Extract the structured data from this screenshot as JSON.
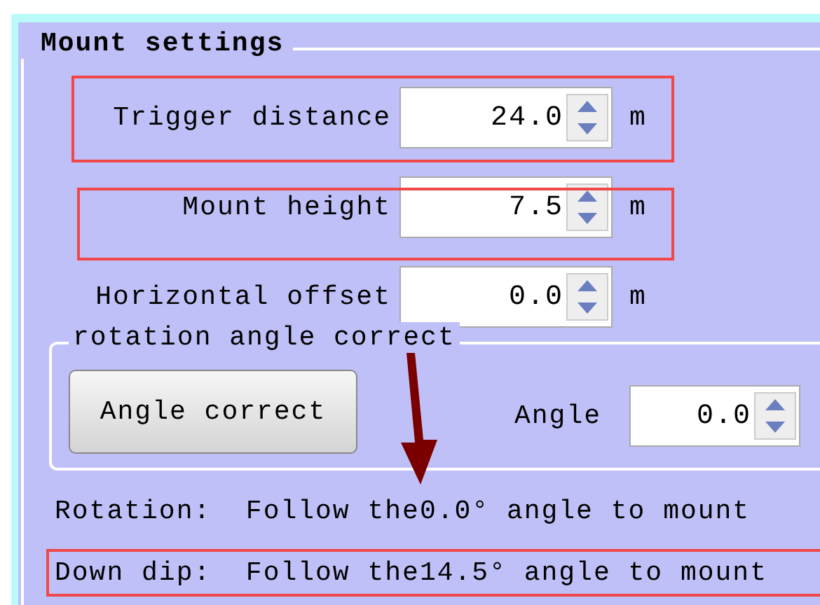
{
  "panel": {
    "title": "Mount settings",
    "fields": [
      {
        "label": "Trigger distance",
        "value": "24.0",
        "unit": "m",
        "highlighted": true
      },
      {
        "label": "Mount height",
        "value": "7.5",
        "unit": "m",
        "highlighted": true
      },
      {
        "label": "Horizontal offset",
        "value": "0.0",
        "unit": "m",
        "highlighted": false
      }
    ],
    "rotation_group": {
      "title": "rotation angle correct",
      "button": "Angle correct",
      "angle_label": "Angle",
      "angle_value": "0.0"
    },
    "status_lines": [
      {
        "text": "Rotation:  Follow the0.0° angle to mount",
        "highlighted": false
      },
      {
        "text": "Down dip:  Follow the14.5° angle to mount",
        "highlighted": true
      }
    ]
  }
}
